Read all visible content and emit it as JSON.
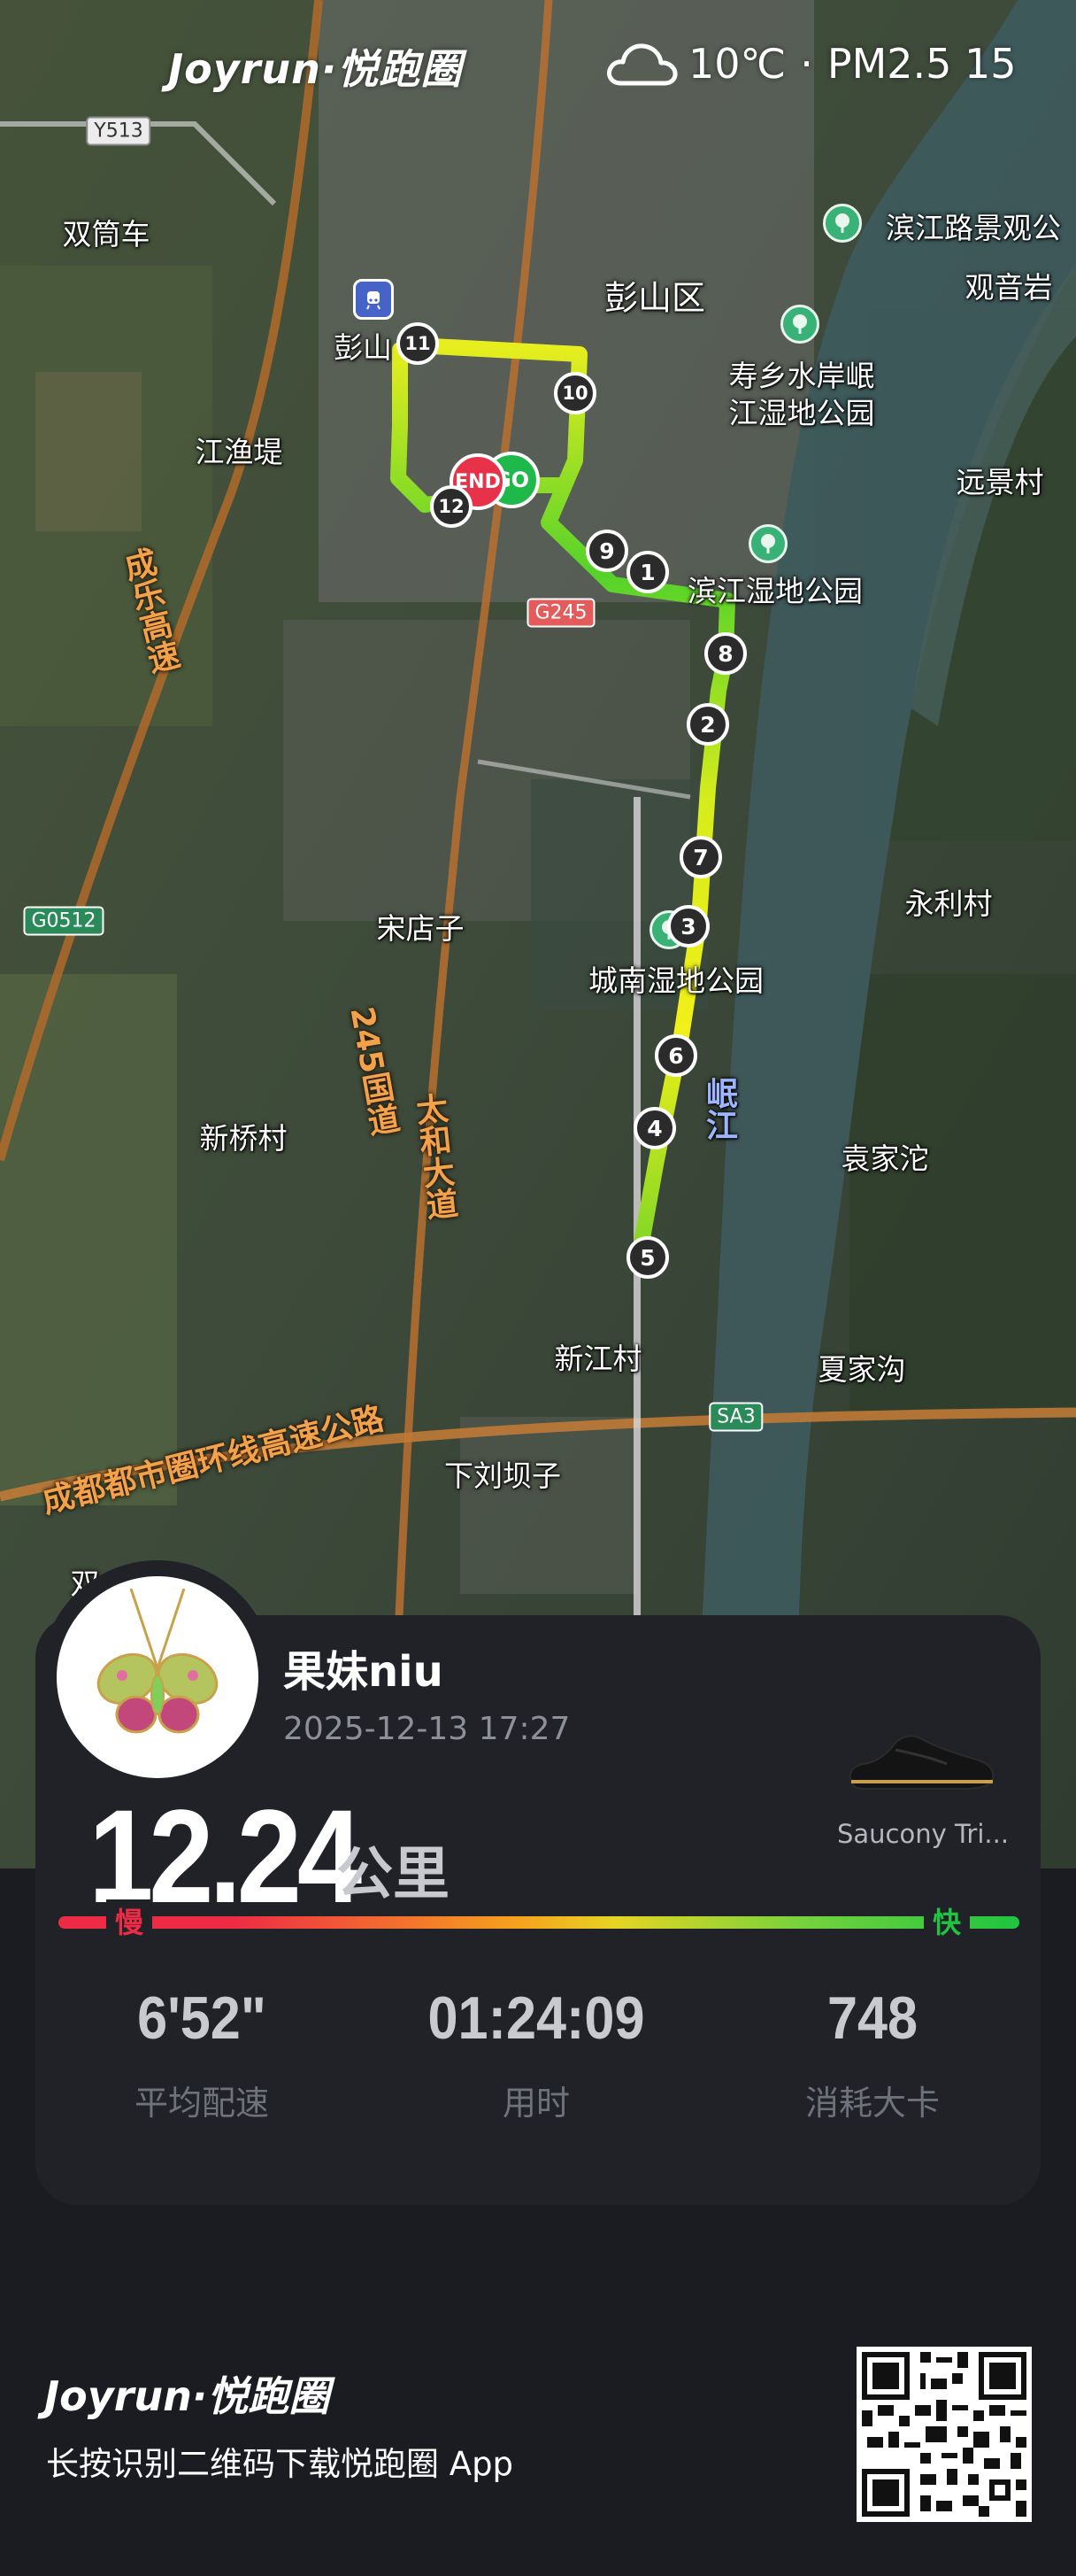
{
  "header": {
    "brand": "Joyrun·悦跑圈",
    "weather_icon": "cloud-icon",
    "temperature": "10℃",
    "separator": "·",
    "air_quality": "PM2.5 15"
  },
  "map": {
    "places": [
      {
        "id": "shuangtongche",
        "label": "双筒车"
      },
      {
        "id": "pengshanqu",
        "label": "彭山区"
      },
      {
        "id": "pengshan",
        "label": "彭山"
      },
      {
        "id": "jiangyudi",
        "label": "江渔堤"
      },
      {
        "id": "binjiang",
        "label": "滨江路景观公"
      },
      {
        "id": "guanyinyan",
        "label": "观音岩"
      },
      {
        "id": "shouxiang1",
        "label": "寿乡水岸岷"
      },
      {
        "id": "shouxiang2",
        "label": "江湿地公园"
      },
      {
        "id": "yuanjingcun",
        "label": "远景村"
      },
      {
        "id": "binjiangshidi",
        "label": "滨江湿地公园"
      },
      {
        "id": "yonglicun",
        "label": "永利村"
      },
      {
        "id": "songdianzi",
        "label": "宋店子"
      },
      {
        "id": "chengnan",
        "label": "城南湿地公园"
      },
      {
        "id": "xinqiaocun",
        "label": "新桥村"
      },
      {
        "id": "yuanjiatuo",
        "label": "袁家沱"
      },
      {
        "id": "xinjiangcun",
        "label": "新江村"
      },
      {
        "id": "xiajiagou",
        "label": "夏家沟"
      },
      {
        "id": "xialiubazi",
        "label": "下刘坝子"
      },
      {
        "id": "shuang",
        "label": "双"
      }
    ],
    "roads": [
      {
        "id": "chengle",
        "label": "成乐高速"
      },
      {
        "id": "guodao",
        "label": "245国道"
      },
      {
        "id": "taihe",
        "label": "太和大道"
      },
      {
        "id": "huanxian",
        "label": "成都都市圈环线高速公路"
      },
      {
        "id": "minjiang",
        "label": "岷江"
      }
    ],
    "shields": [
      {
        "id": "y513",
        "label": "Y513"
      },
      {
        "id": "g245",
        "label": "G245"
      },
      {
        "id": "g0512",
        "label": "G0512"
      },
      {
        "id": "sa3",
        "label": "SA3"
      }
    ],
    "km_markers": [
      "1",
      "2",
      "3",
      "4",
      "5",
      "6",
      "7",
      "8",
      "9",
      "10",
      "11",
      "12"
    ],
    "start_label": "GO",
    "end_label": "END"
  },
  "profile": {
    "username": "果妹niu",
    "datetime": "2025-12-13 17:27",
    "avatar_icon": "butterfly-necklace-avatar"
  },
  "shoe": {
    "name": "Saucony Tri..."
  },
  "run": {
    "distance": "12.24",
    "distance_unit": "公里",
    "slow_label": "慢",
    "fast_label": "快",
    "stats": [
      {
        "value": "6'52\"",
        "label": "平均配速"
      },
      {
        "value": "01:24:09",
        "label": "用时"
      },
      {
        "value": "748",
        "label": "消耗大卡"
      }
    ]
  },
  "footer": {
    "brand": "Joyrun·悦跑圈",
    "caption": "长按识别二维码下载悦跑圈 App"
  },
  "colors": {
    "card_bg": "#202228",
    "page_bg": "#1b1c22",
    "slow": "#ee2b45",
    "fast": "#1fc440"
  }
}
